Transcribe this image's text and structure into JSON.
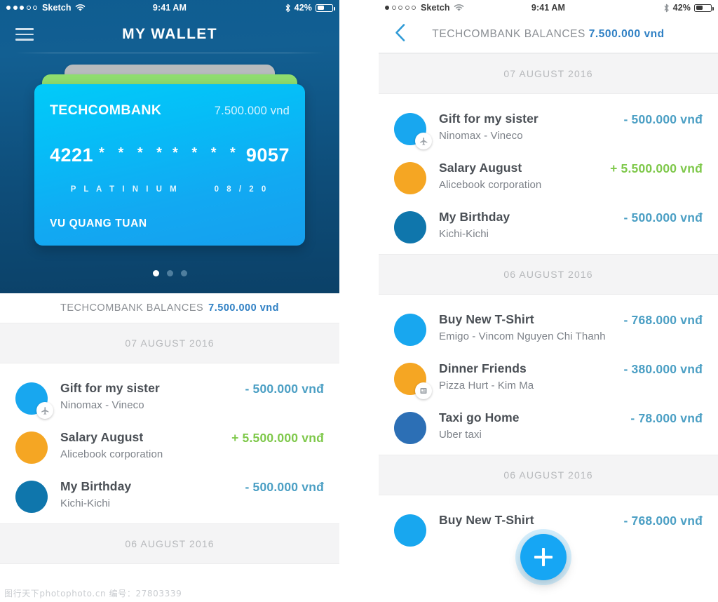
{
  "left_phone": {
    "status_bar": {
      "carrier": "Sketch",
      "signal_filled": 3,
      "signal_total": 5,
      "time": "9:41 AM",
      "battery_pct": "42%",
      "wifi_icon": "wifi-icon",
      "bluetooth_icon": "bluetooth-icon",
      "battery_icon": "battery-icon"
    },
    "navbar": {
      "menu_icon": "hamburger-menu-icon",
      "title": "MY WALLET"
    },
    "card": {
      "bank_name": "TECHCOMBANK",
      "balance": "7.500.000 vnd",
      "number_prefix": "4221",
      "number_mask_1": "* * * *",
      "number_mask_2": "* * * *",
      "number_suffix": "9057",
      "tier": "P L A T I N I U M",
      "expiry": "0 8 / 2 0",
      "holder": "VU QUANG TUAN",
      "front_color": "#06bdf7",
      "second_card_color": "#8fdd6e",
      "third_card_color": "#b7bbbd"
    },
    "pager": {
      "total": 3,
      "active_index": 0
    },
    "balance_bar": {
      "label": "TECHCOMBANK BALANCES",
      "amount": "7.500.000 vnd"
    },
    "sections": [
      {
        "date": "07 AUGUST 2016",
        "transactions": [
          {
            "title": "Gift for my sister",
            "subtitle": "Ninomax - Vineco",
            "amount": "- 500.000 vnđ",
            "sign": "neg",
            "avatar_color": "#18a7ef",
            "badge_icon": "airplane-icon"
          },
          {
            "title": "Salary August",
            "subtitle": "Alicebook corporation",
            "amount": "+ 5.500.000 vnđ",
            "sign": "pos",
            "avatar_color": "#f5a623",
            "badge_icon": null
          },
          {
            "title": "My Birthday",
            "subtitle": "Kichi-Kichi",
            "amount": "- 500.000 vnđ",
            "sign": "neg",
            "avatar_color": "#0f76ac",
            "badge_icon": null
          }
        ]
      },
      {
        "date": "06 AUGUST 2016",
        "transactions": []
      }
    ]
  },
  "right_phone": {
    "status_bar": {
      "carrier": "Sketch",
      "signal_filled": 1,
      "signal_total": 5,
      "time": "9:41 AM",
      "battery_pct": "42%",
      "wifi_icon": "wifi-icon",
      "bluetooth_icon": "bluetooth-icon",
      "battery_icon": "battery-icon"
    },
    "navbar": {
      "back_icon": "chevron-left-icon",
      "label": "TECHCOMBANK BALANCES",
      "amount": "7.500.000 vnd"
    },
    "sections": [
      {
        "date": "07 AUGUST 2016",
        "transactions": [
          {
            "title": "Gift for my sister",
            "subtitle": "Ninomax - Vineco",
            "amount": "- 500.000 vnđ",
            "sign": "neg",
            "avatar_color": "#18a7ef",
            "badge_icon": "airplane-icon"
          },
          {
            "title": "Salary August",
            "subtitle": "Alicebook corporation",
            "amount": "+ 5.500.000 vnđ",
            "sign": "pos",
            "avatar_color": "#f5a623",
            "badge_icon": null
          },
          {
            "title": "My Birthday",
            "subtitle": "Kichi-Kichi",
            "amount": "- 500.000 vnđ",
            "sign": "neg",
            "avatar_color": "#0f76ac",
            "badge_icon": null
          }
        ]
      },
      {
        "date": "06 AUGUST 2016",
        "transactions": [
          {
            "title": "Buy New T-Shirt",
            "subtitle": "Emigo - Vincom Nguyen Chi Thanh",
            "amount": "- 768.000 vnđ",
            "sign": "neg",
            "avatar_color": "#18a7ef",
            "badge_icon": null
          },
          {
            "title": "Dinner Friends",
            "subtitle": "Pizza Hurt - Kim Ma",
            "amount": "- 380.000 vnđ",
            "sign": "neg",
            "avatar_color": "#f5a623",
            "badge_icon": "receipt-icon"
          },
          {
            "title": "Taxi go Home",
            "subtitle": "Uber taxi",
            "amount": "- 78.000 vnđ",
            "sign": "neg",
            "avatar_color": "#2c6fb5",
            "badge_icon": null
          }
        ]
      },
      {
        "date": "06 AUGUST 2016",
        "transactions": [
          {
            "title": "Buy New T-Shirt",
            "subtitle": "",
            "amount": "- 768.000 vnđ",
            "sign": "neg",
            "avatar_color": "#18a7ef",
            "badge_icon": null
          }
        ]
      }
    ],
    "fab": {
      "icon": "plus-icon",
      "color": "#16a6f4"
    }
  },
  "watermark": "图行天下photophoto.cn  编号：27803339",
  "colors": {
    "hero_blue": "#125f92",
    "accent_blue": "#2f80c4",
    "negative": "#4b9fc4",
    "positive": "#7ec84a",
    "section_bg": "#f4f4f5"
  }
}
